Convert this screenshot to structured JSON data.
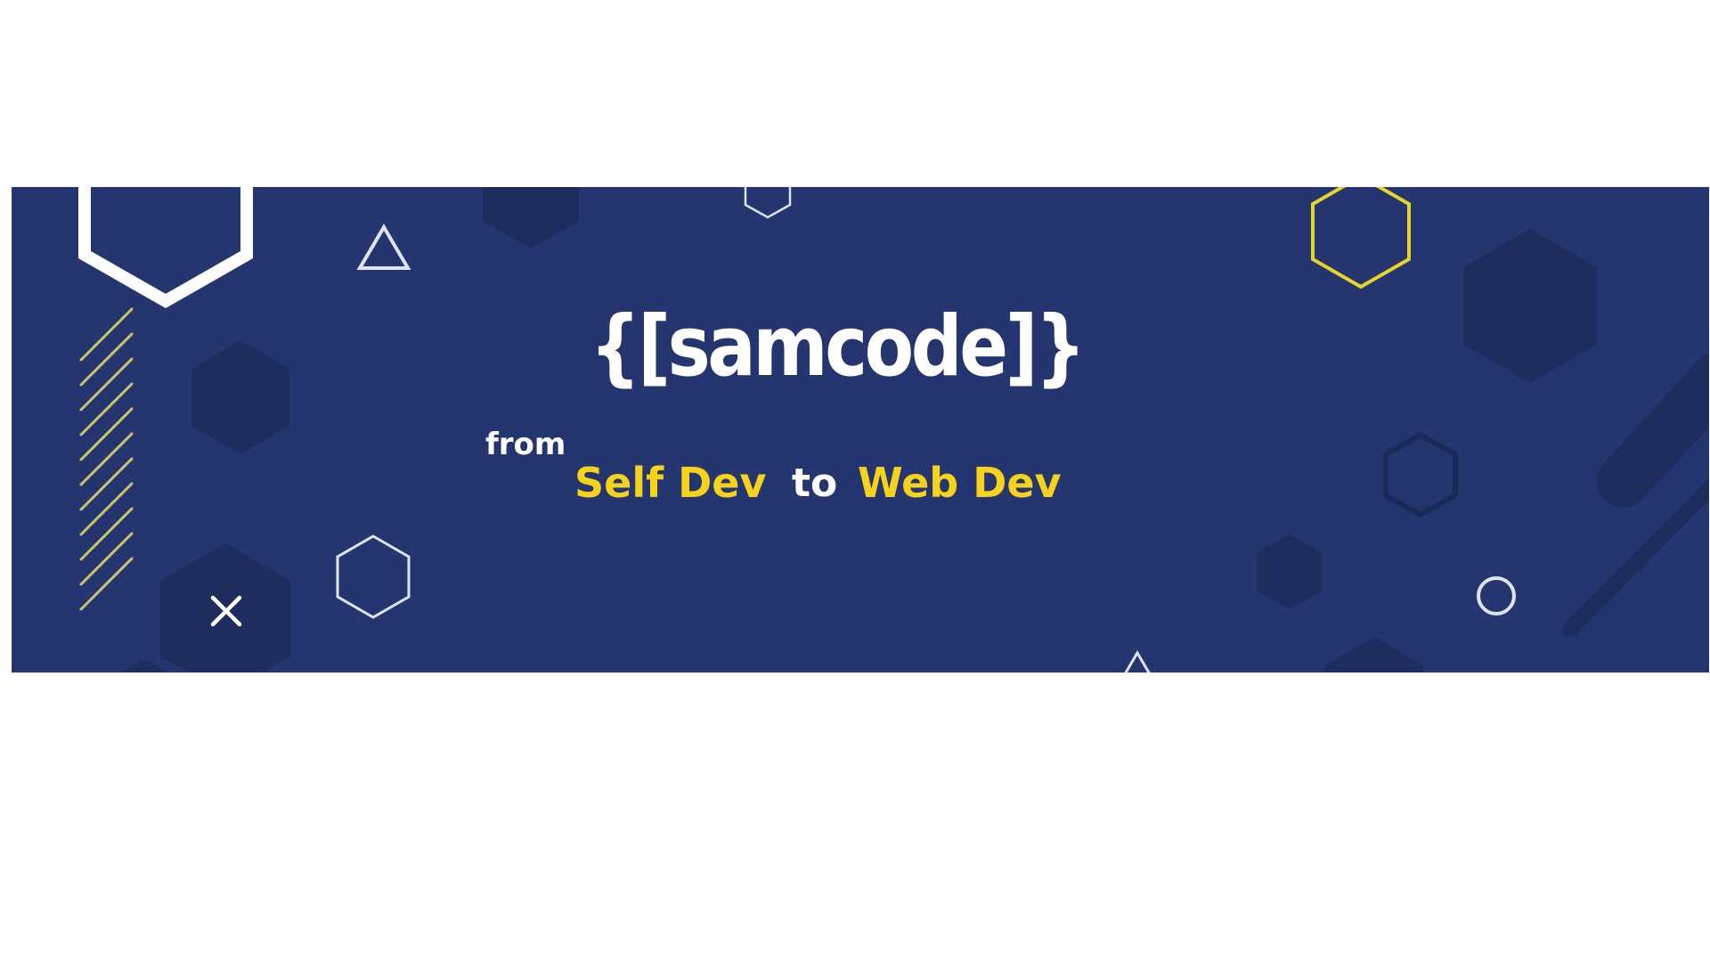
{
  "colors": {
    "page_background": "#ffffff",
    "banner_background": "#253570",
    "shape_dark": "#1f2c5e",
    "outline_light": "#dfe4f2",
    "accent_yellow": "#f5d21b",
    "stripe_yellow": "#c9c66a",
    "text_white": "#ffffff"
  },
  "banner": {
    "brand": "{[samcode]}",
    "from_label": "from",
    "self_dev_label": "Self Dev",
    "to_label": "to",
    "web_dev_label": "Web Dev"
  },
  "icons": [
    "hexagon-outline-icon",
    "triangle-outline-icon",
    "diagonal-stripes-icon",
    "cross-icon",
    "circle-outline-icon",
    "yellow-hexagon-outline-icon"
  ]
}
